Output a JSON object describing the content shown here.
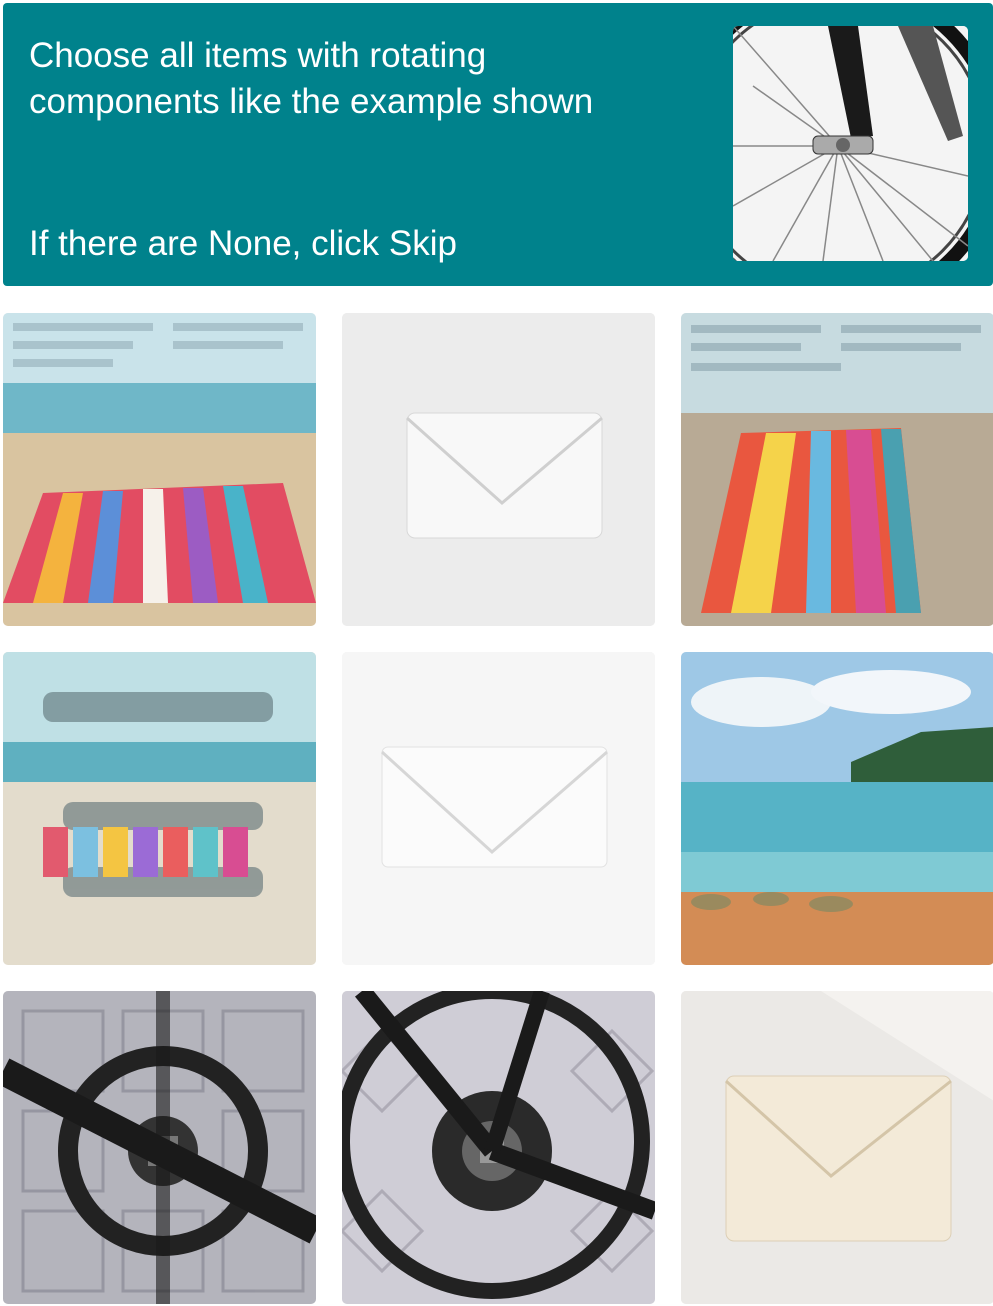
{
  "header": {
    "prompt": "Choose all items with rotating components like the example shown",
    "skip_hint": "If there are None, click Skip",
    "background_color": "#00828c",
    "example_icon": "bicycle-wheel-icon"
  },
  "grid": {
    "tiles": [
      {
        "id": 1,
        "subject": "beach-towel-sand"
      },
      {
        "id": 2,
        "subject": "white-envelope"
      },
      {
        "id": 3,
        "subject": "beach-towel-sand"
      },
      {
        "id": 4,
        "subject": "beach-towel-distorted-text"
      },
      {
        "id": 5,
        "subject": "white-envelope"
      },
      {
        "id": 6,
        "subject": "lake-shoreline"
      },
      {
        "id": 7,
        "subject": "bicycle-crankset"
      },
      {
        "id": 8,
        "subject": "bicycle-crankset"
      },
      {
        "id": 9,
        "subject": "cream-envelope"
      }
    ]
  }
}
